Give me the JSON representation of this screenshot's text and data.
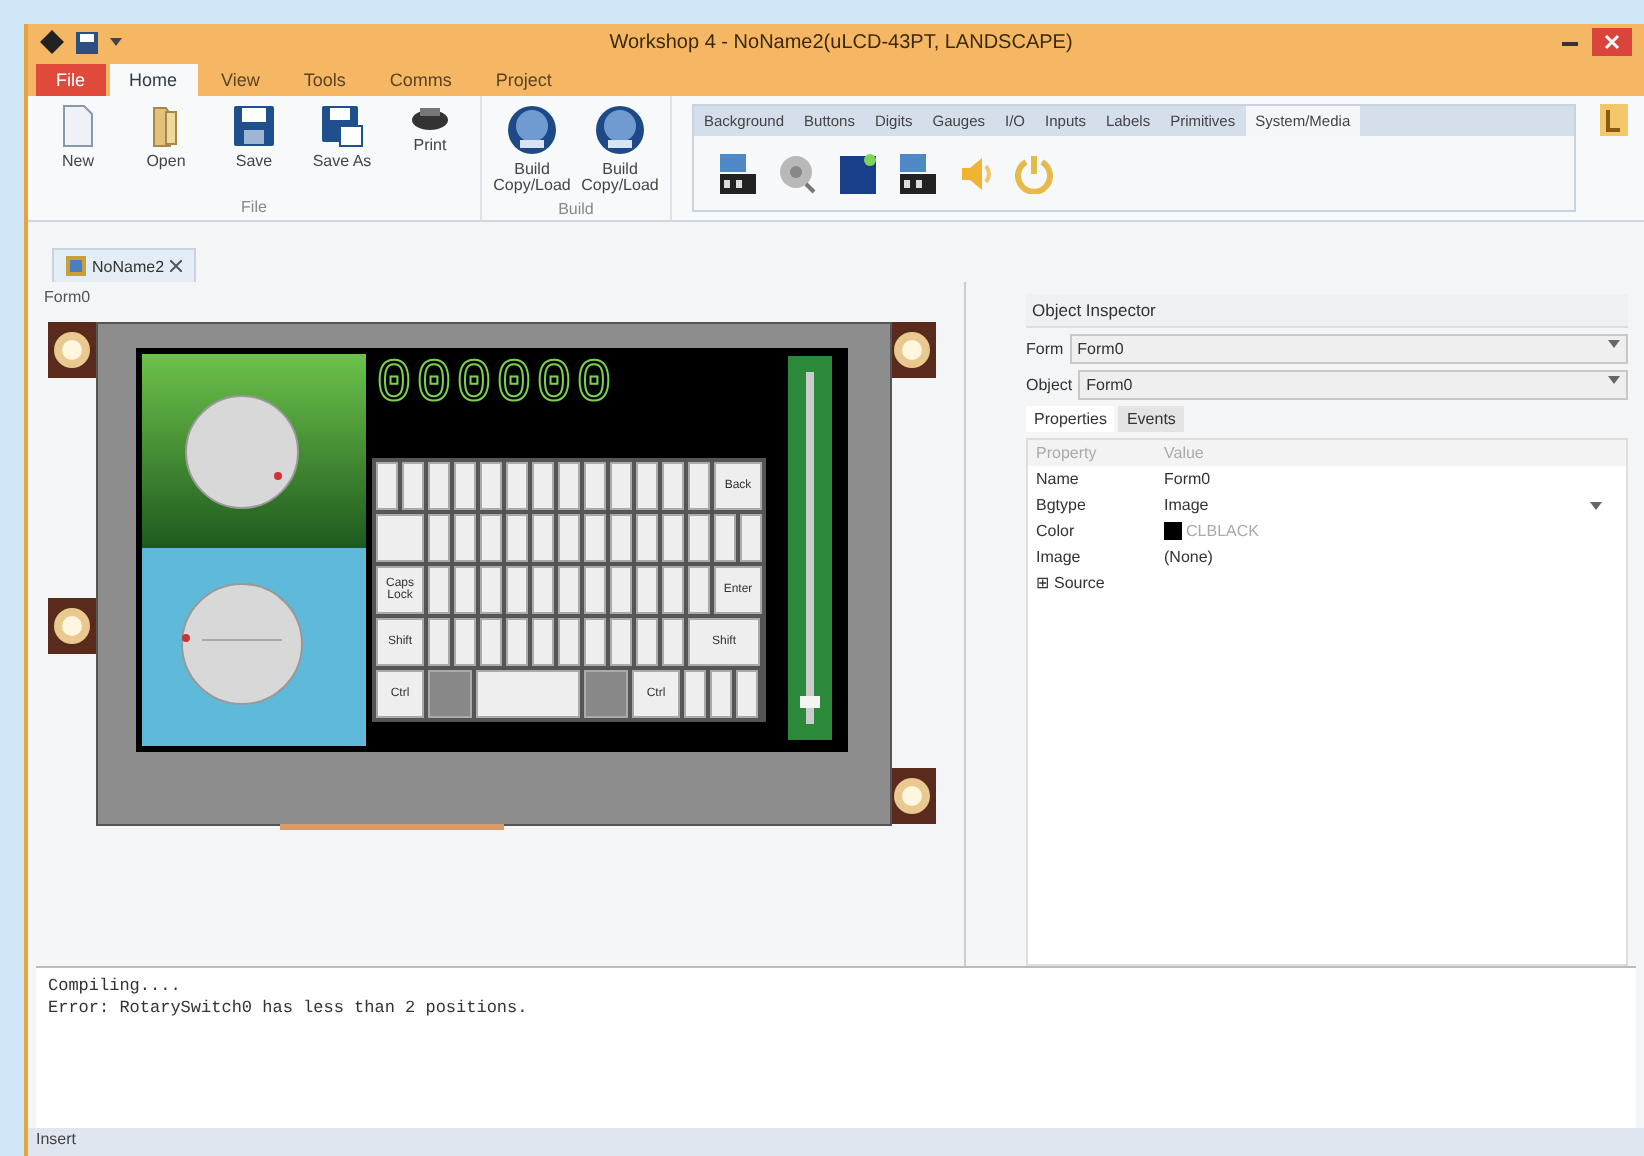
{
  "window": {
    "title": "Workshop 4 - NoName2(uLCD-43PT, LANDSCAPE)"
  },
  "ribbon_tabs": [
    {
      "label": "File",
      "kind": "file",
      "selected": false
    },
    {
      "label": "Home",
      "kind": "tab",
      "selected": true
    },
    {
      "label": "View",
      "kind": "tab",
      "selected": false
    },
    {
      "label": "Tools",
      "kind": "tab",
      "selected": false
    },
    {
      "label": "Comms",
      "kind": "tab",
      "selected": false
    },
    {
      "label": "Project",
      "kind": "tab",
      "selected": false
    }
  ],
  "ribbon_groups": [
    {
      "label": "File",
      "buttons": [
        {
          "label": "New",
          "kind": "new"
        },
        {
          "label": "Open",
          "kind": "open"
        },
        {
          "label": "Save",
          "kind": "save"
        },
        {
          "label": "Save As",
          "kind": "saveas"
        },
        {
          "label": "Print",
          "kind": "print"
        }
      ]
    },
    {
      "label": "Build",
      "buttons": [
        {
          "label": "Build Copy/Load",
          "kind": "build"
        },
        {
          "label": "Build Copy/Load",
          "kind": "build"
        }
      ]
    }
  ],
  "widget_tabs": [
    {
      "label": "Background",
      "selected": false
    },
    {
      "label": "Buttons",
      "selected": false
    },
    {
      "label": "Digits",
      "selected": false
    },
    {
      "label": "Gauges",
      "selected": false
    },
    {
      "label": "I/O",
      "selected": false
    },
    {
      "label": "Inputs",
      "selected": false
    },
    {
      "label": "Labels",
      "selected": false
    },
    {
      "label": "Primitives",
      "selected": false
    },
    {
      "label": "System/Media",
      "selected": true
    }
  ],
  "widget_icons": [
    {
      "kind": "video"
    },
    {
      "kind": "sound-disc"
    },
    {
      "kind": "image"
    },
    {
      "kind": "video"
    },
    {
      "kind": "speaker"
    },
    {
      "kind": "power"
    }
  ],
  "document_tab": {
    "label": "NoName2"
  },
  "form_label": "Form0",
  "display": {
    "digits": "000000",
    "slider": {
      "level": 0.05
    },
    "keyboard": [
      [
        {
          "kind": "char"
        },
        {
          "kind": "char"
        },
        {
          "kind": "char"
        },
        {
          "kind": "char"
        },
        {
          "kind": "char"
        },
        {
          "kind": "char"
        },
        {
          "kind": "char"
        },
        {
          "kind": "char"
        },
        {
          "kind": "char"
        },
        {
          "kind": "char"
        },
        {
          "kind": "char"
        },
        {
          "kind": "char"
        },
        {
          "kind": "char"
        },
        {
          "kind": "wide",
          "label": "Back"
        }
      ],
      [
        {
          "kind": "wide"
        },
        {
          "kind": "char"
        },
        {
          "kind": "char"
        },
        {
          "kind": "char"
        },
        {
          "kind": "char"
        },
        {
          "kind": "char"
        },
        {
          "kind": "char"
        },
        {
          "kind": "char"
        },
        {
          "kind": "char"
        },
        {
          "kind": "char"
        },
        {
          "kind": "char"
        },
        {
          "kind": "char"
        },
        {
          "kind": "char"
        },
        {
          "kind": "char"
        }
      ],
      [
        {
          "kind": "wide",
          "label": "Caps Lock"
        },
        {
          "kind": "char"
        },
        {
          "kind": "char"
        },
        {
          "kind": "char"
        },
        {
          "kind": "char"
        },
        {
          "kind": "char"
        },
        {
          "kind": "char"
        },
        {
          "kind": "char"
        },
        {
          "kind": "char"
        },
        {
          "kind": "char"
        },
        {
          "kind": "char"
        },
        {
          "kind": "char"
        },
        {
          "kind": "wide",
          "label": "Enter"
        }
      ],
      [
        {
          "kind": "wide",
          "label": "Shift"
        },
        {
          "kind": "char"
        },
        {
          "kind": "char"
        },
        {
          "kind": "char"
        },
        {
          "kind": "char"
        },
        {
          "kind": "char"
        },
        {
          "kind": "char"
        },
        {
          "kind": "char"
        },
        {
          "kind": "char"
        },
        {
          "kind": "char"
        },
        {
          "kind": "char"
        },
        {
          "kind": "xwide",
          "label": "Shift"
        }
      ],
      [
        {
          "kind": "wide",
          "label": "Ctrl"
        },
        {
          "kind": "dark"
        },
        {
          "kind": "space"
        },
        {
          "kind": "dark"
        },
        {
          "kind": "wide",
          "label": "Ctrl"
        },
        {
          "kind": "char"
        },
        {
          "kind": "char"
        },
        {
          "kind": "char"
        }
      ]
    ]
  },
  "inspector": {
    "title": "Object Inspector",
    "combos": [
      {
        "label": "Form",
        "value": "Form0"
      },
      {
        "label": "Object",
        "value": "Form0"
      }
    ],
    "tabs": [
      {
        "label": "Properties",
        "selected": true
      },
      {
        "label": "Events",
        "selected": false
      }
    ],
    "columns": [
      "Property",
      "Value"
    ],
    "rows": [
      {
        "property": "Name",
        "value": "Form0",
        "kind": "text"
      },
      {
        "property": "Bgtype",
        "value": "Image",
        "kind": "dropdown"
      },
      {
        "property": "Color",
        "value": "CLBLACK",
        "kind": "color",
        "color": "#000000"
      },
      {
        "property": "Image",
        "value": "(None)",
        "kind": "text"
      },
      {
        "property": "Source",
        "kind": "expander",
        "expander": "⊞"
      }
    ]
  },
  "output": [
    "Compiling....",
    "Error: RotarySwitch0 has less than 2 positions."
  ],
  "status_bar": "Insert"
}
